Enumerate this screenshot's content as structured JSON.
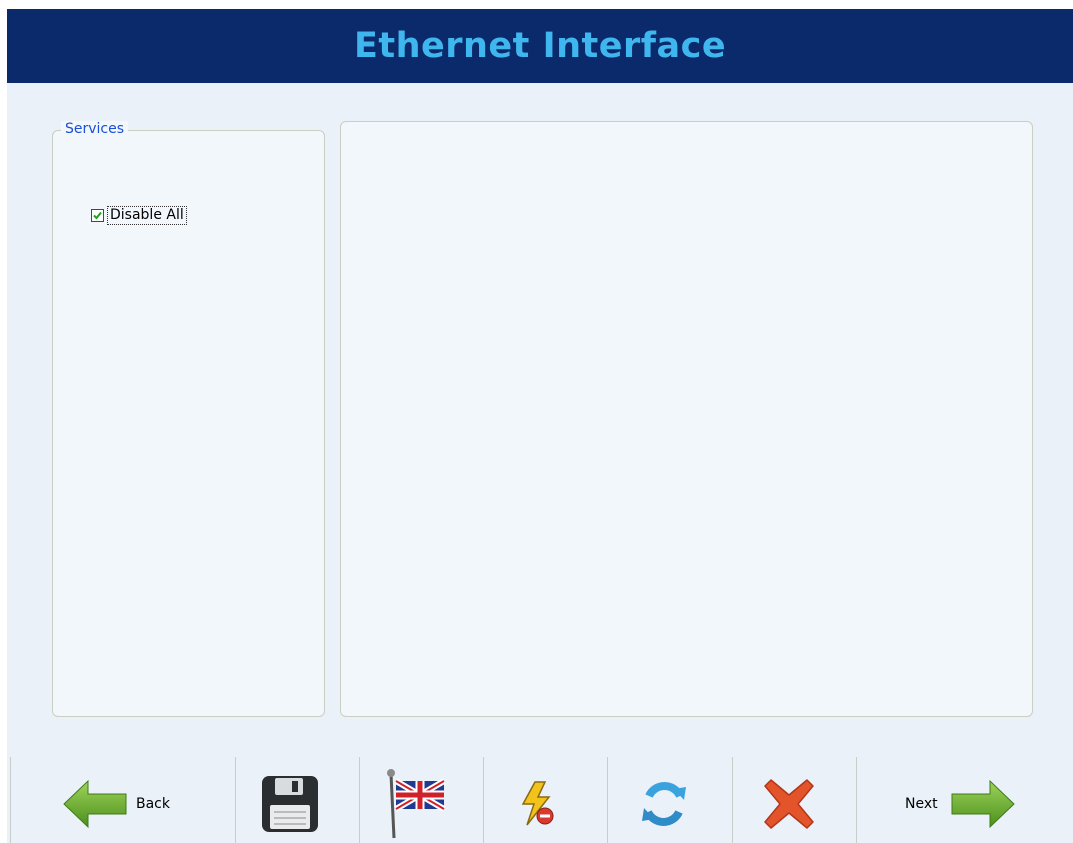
{
  "header": {
    "title": "Ethernet Interface"
  },
  "services": {
    "legend": "Services",
    "disable_all": {
      "label": "Disable All",
      "checked": true
    }
  },
  "toolbar": {
    "back_label": "Back",
    "next_label": "Next",
    "icons": [
      "back-arrow-icon",
      "save-icon",
      "language-flag-icon",
      "lightning-remove-icon",
      "refresh-icon",
      "cancel-icon",
      "next-arrow-icon"
    ]
  },
  "colors": {
    "title_bar": "#0b2a6b",
    "title_text": "#3fb7ee",
    "legend_text": "#1a4fd6",
    "background": "#eaf1f9"
  }
}
